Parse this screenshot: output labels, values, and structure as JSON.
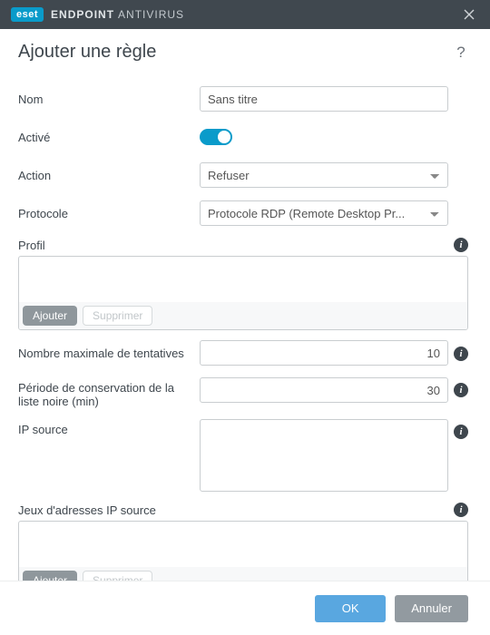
{
  "titlebar": {
    "badge": "eset",
    "product1": "ENDPOINT",
    "product2": "ANTIVIRUS"
  },
  "heading": "Ajouter une règle",
  "labels": {
    "name": "Nom",
    "enabled": "Activé",
    "action": "Action",
    "protocol": "Protocole",
    "profile": "Profil",
    "maxAttempts": "Nombre maximale de tentatives",
    "blacklistRetain": "Période de conservation de la liste noire (min)",
    "sourceIp": "IP source",
    "sourceIpSets": "Jeux d'adresses IP source"
  },
  "values": {
    "name": "Sans titre",
    "action": "Refuser",
    "protocol": "Protocole RDP (Remote Desktop Pr...",
    "maxAttempts": "10",
    "blacklistRetain": "30"
  },
  "pillLabels": {
    "add": "Ajouter",
    "delete": "Supprimer"
  },
  "footer": {
    "ok": "OK",
    "cancel": "Annuler"
  }
}
